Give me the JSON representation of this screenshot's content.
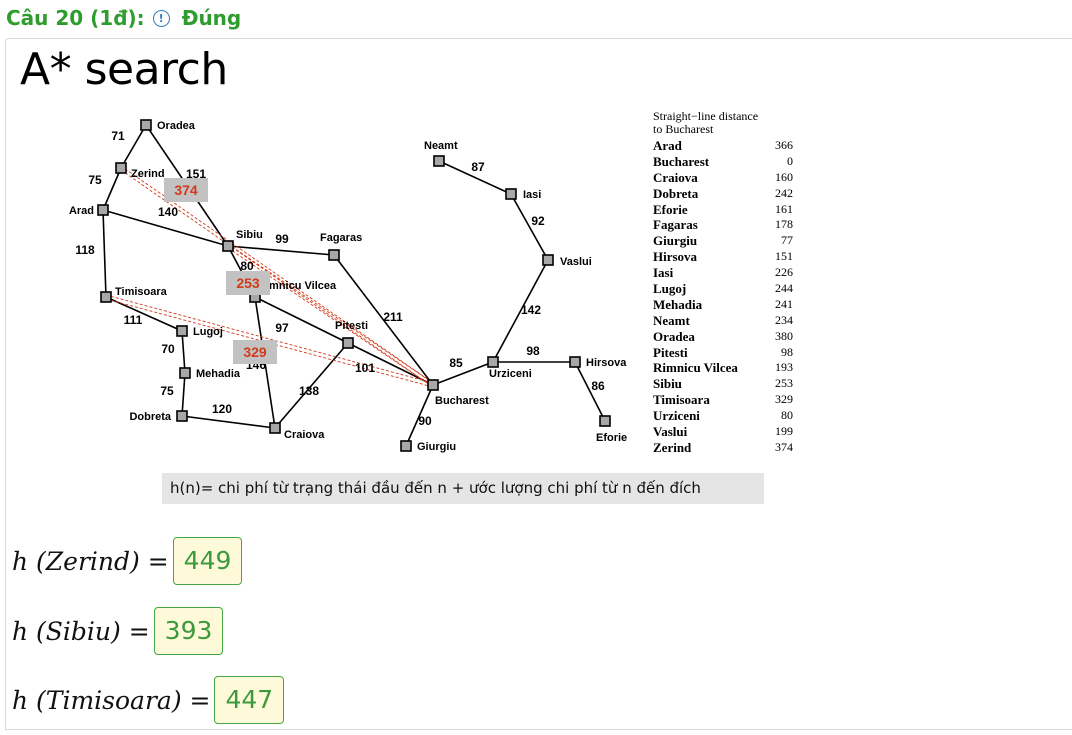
{
  "question": {
    "title": "Câu 20 (1đ):",
    "info_icon": "!",
    "result": "Đúng"
  },
  "panel_title": "A* search",
  "map": {
    "cities": [
      {
        "id": "oradea",
        "name": "Oradea"
      },
      {
        "id": "zerind",
        "name": "Zerind"
      },
      {
        "id": "arad",
        "name": "Arad"
      },
      {
        "id": "sibiu",
        "name": "Sibiu"
      },
      {
        "id": "fagaras",
        "name": "Fagaras"
      },
      {
        "id": "timisoara",
        "name": "Timisoara"
      },
      {
        "id": "rimnicu",
        "name": "imnicu Vilcea"
      },
      {
        "id": "lugoj",
        "name": "Lugoj"
      },
      {
        "id": "pitesti",
        "name": "Pitesti"
      },
      {
        "id": "mehadia",
        "name": "Mehadia"
      },
      {
        "id": "dobreta",
        "name": "Dobreta"
      },
      {
        "id": "craiova",
        "name": "Craiova"
      },
      {
        "id": "bucharest",
        "name": "Bucharest"
      },
      {
        "id": "giurgiu",
        "name": "Giurgiu"
      },
      {
        "id": "urziceni",
        "name": "Urziceni"
      },
      {
        "id": "hirsova",
        "name": "Hirsova"
      },
      {
        "id": "eforie",
        "name": "Eforie"
      },
      {
        "id": "vaslui",
        "name": "Vaslui"
      },
      {
        "id": "iasi",
        "name": "Iasi"
      },
      {
        "id": "neamt",
        "name": "Neamt"
      }
    ],
    "roads": [
      {
        "from": "oradea",
        "to": "zerind",
        "cost": "71"
      },
      {
        "from": "oradea",
        "to": "sibiu",
        "cost": "151"
      },
      {
        "from": "zerind",
        "to": "arad",
        "cost": "75"
      },
      {
        "from": "arad",
        "to": "sibiu",
        "cost": "140"
      },
      {
        "from": "arad",
        "to": "timisoara",
        "cost": "118"
      },
      {
        "from": "timisoara",
        "to": "lugoj",
        "cost": "111"
      },
      {
        "from": "lugoj",
        "to": "mehadia",
        "cost": "70"
      },
      {
        "from": "mehadia",
        "to": "dobreta",
        "cost": "75"
      },
      {
        "from": "dobreta",
        "to": "craiova",
        "cost": "120"
      },
      {
        "from": "sibiu",
        "to": "fagaras",
        "cost": "99"
      },
      {
        "from": "sibiu",
        "to": "rimnicu",
        "cost": "80"
      },
      {
        "from": "rimnicu",
        "to": "pitesti",
        "cost": "97"
      },
      {
        "from": "rimnicu",
        "to": "craiova",
        "cost": "146"
      },
      {
        "from": "craiova",
        "to": "pitesti",
        "cost": "138"
      },
      {
        "from": "pitesti",
        "to": "bucharest",
        "cost": "101"
      },
      {
        "from": "fagaras",
        "to": "bucharest",
        "cost": "211"
      },
      {
        "from": "bucharest",
        "to": "giurgiu",
        "cost": "90"
      },
      {
        "from": "bucharest",
        "to": "urziceni",
        "cost": "85"
      },
      {
        "from": "urziceni",
        "to": "hirsova",
        "cost": "98"
      },
      {
        "from": "hirsova",
        "to": "eforie",
        "cost": "86"
      },
      {
        "from": "urziceni",
        "to": "vaslui",
        "cost": "142"
      },
      {
        "from": "vaslui",
        "to": "iasi",
        "cost": "92"
      },
      {
        "from": "iasi",
        "to": "neamt",
        "cost": "87"
      }
    ],
    "sld_lines": [
      {
        "from": "zerind",
        "to": "bucharest"
      },
      {
        "from": "sibiu",
        "to": "bucharest"
      },
      {
        "from": "timisoara",
        "to": "bucharest"
      }
    ],
    "heuristic_badges": [
      {
        "id": "zerind",
        "value": "374"
      },
      {
        "id": "sibiu",
        "value": "253"
      },
      {
        "id": "timisoara",
        "value": "329"
      }
    ],
    "colors": {
      "node_fill": "#a8a8a8",
      "edge": "#000000",
      "sld_line": "#d23a1a",
      "badge_bg": "#c2c2c2",
      "badge_text": "#d23a1a"
    }
  },
  "legend": {
    "heading_line1": "Straight−line distance",
    "heading_line2": "to Bucharest",
    "rows": [
      {
        "city": "Arad",
        "dist": "366"
      },
      {
        "city": "Bucharest",
        "dist": "0"
      },
      {
        "city": "Craiova",
        "dist": "160"
      },
      {
        "city": "Dobreta",
        "dist": "242"
      },
      {
        "city": "Eforie",
        "dist": "161"
      },
      {
        "city": "Fagaras",
        "dist": "178"
      },
      {
        "city": "Giurgiu",
        "dist": "77"
      },
      {
        "city": "Hirsova",
        "dist": "151"
      },
      {
        "city": "Iasi",
        "dist": "226"
      },
      {
        "city": "Lugoj",
        "dist": "244"
      },
      {
        "city": "Mehadia",
        "dist": "241"
      },
      {
        "city": "Neamt",
        "dist": "234"
      },
      {
        "city": "Oradea",
        "dist": "380"
      },
      {
        "city": "Pitesti",
        "dist": "98"
      },
      {
        "city": "Rimnicu Vilcea",
        "dist": "193"
      },
      {
        "city": "Sibiu",
        "dist": "253"
      },
      {
        "city": "Timisoara",
        "dist": "329"
      },
      {
        "city": "Urziceni",
        "dist": "80"
      },
      {
        "city": "Vaslui",
        "dist": "199"
      },
      {
        "city": "Zerind",
        "dist": "374"
      }
    ]
  },
  "hn_note": "h(n)= chi phí từ trạng thái đầu đến n + ước lượng chi phí từ n đến đích",
  "answers": [
    {
      "label": "h (Zerind) =",
      "value": "449"
    },
    {
      "label": "h (Sibiu) =",
      "value": "393"
    },
    {
      "label": "h (Timisoara) =",
      "value": "447"
    }
  ]
}
